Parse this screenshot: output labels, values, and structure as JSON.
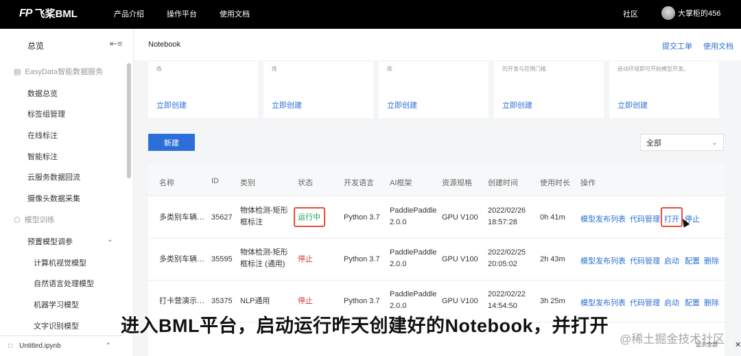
{
  "topbar": {
    "logo_mark": "FP",
    "logo_text": "飞桨BML",
    "nav": [
      "产品介绍",
      "操作平台",
      "使用文档"
    ],
    "community": "社区",
    "username": "大掌柜的456"
  },
  "sidebar": {
    "title": "总览",
    "groups": [
      {
        "label": "EasyData智能数据服务",
        "icon": "chart-icon"
      },
      {
        "label": "模型训练",
        "icon": "cube-icon"
      }
    ],
    "data_items": [
      "数据总览",
      "标签组管理",
      "在线标注",
      "智能标注",
      "云服务数据回流",
      "摄像头数据采集"
    ],
    "training_item": "预置模型调参",
    "sub_items": [
      "计算机视觉模型",
      "自然语言处理模型",
      "机器学习模型",
      "文字识别模型"
    ]
  },
  "filebar": {
    "filename": "Untitled.ipynb"
  },
  "header": {
    "breadcrumb": "Notebook",
    "links": [
      "提交工单",
      "使用文档"
    ]
  },
  "cards": [
    {
      "desc": "练",
      "link": "立即创建"
    },
    {
      "desc": "练",
      "link": "立即创建"
    },
    {
      "desc": "练",
      "link": "立即创建"
    },
    {
      "desc": "的开发与应用门槛",
      "link": "立即创建"
    },
    {
      "desc": "启动环境即可开始模型开发。",
      "link": "立即创建"
    }
  ],
  "toolbar": {
    "new_button": "新建",
    "filter_value": "全部"
  },
  "table": {
    "columns": [
      "名称",
      "ID",
      "类别",
      "状态",
      "开发语言",
      "AI框架",
      "资源规格",
      "创建时间",
      "使用时长",
      "操作"
    ],
    "rows": [
      {
        "name": "多类别车辆…",
        "id": "35627",
        "category": [
          "物体检测-矩形",
          "框标注"
        ],
        "status": "运行中",
        "lang": "Python 3.7",
        "framework": [
          "PaddlePaddle",
          "2.0.0"
        ],
        "resource": "GPU V100",
        "created": [
          "2022/02/26",
          "18:57:28"
        ],
        "duration": "0h 41m",
        "actions": [
          "模型发布列表",
          "代码管理",
          "打开",
          "停止"
        ]
      },
      {
        "name": "多类别车辆…",
        "id": "35595",
        "category": [
          "物体检测-矩形",
          "框标注 (通用)"
        ],
        "status": "停止",
        "lang": "Python 3.7",
        "framework": [
          "PaddlePaddle",
          "2.0.0"
        ],
        "resource": "GPU V100",
        "created": [
          "2022/02/25",
          "20:05:02"
        ],
        "duration": "2h 43m",
        "actions": [
          "模型发布列表",
          "代码管理",
          "启动",
          "配置",
          "删除"
        ]
      },
      {
        "name": "打卡营演示…",
        "id": "35375",
        "category": [
          "NLP通用"
        ],
        "status": "停止",
        "lang": "Python 3.7",
        "framework": [
          "PaddlePaddle",
          "2.0.0"
        ],
        "resource": "GPU V100",
        "created": [
          "2022/02/22",
          "14:54:50"
        ],
        "duration": "3h 25m",
        "actions": [
          "模型发布列表",
          "代码管理",
          "启动",
          "配置",
          "删除"
        ]
      }
    ]
  },
  "overlay": {
    "subtitle": "进入BML平台，启动运行昨天创建好的Notebook，并打开",
    "watermark": "@稀土掘金技术社区",
    "show_all": "显示全部"
  }
}
